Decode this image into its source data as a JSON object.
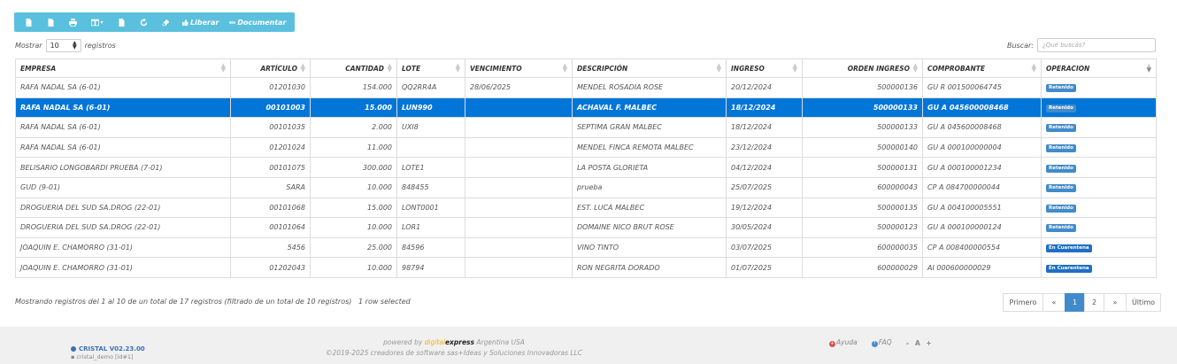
{
  "toolbar": {
    "icons": [
      "file-icon",
      "file-icon",
      "print-icon",
      "columns-icon",
      "file-icon",
      "refresh-icon",
      "eraser-icon"
    ],
    "liberar_label": "Liberar",
    "documentar_label": "Documentar"
  },
  "length": {
    "label_pre": "Mostrar",
    "value": "10",
    "label_post": "registros"
  },
  "search": {
    "label": "Buscar:",
    "placeholder": "¿Qué buscás?"
  },
  "table": {
    "headers": [
      "EMPRESA",
      "ARTÍCULO",
      "CANTIDAD",
      "LOTE",
      "VENCIMIENTO",
      "DESCRIPCIÓN",
      "INGRESO",
      "ORDEN INGRESO",
      "COMPROBANTE",
      "OPERACION"
    ],
    "rows": [
      {
        "empresa": "RAFA NADAL SA (6-01)",
        "articulo": "01201030",
        "cantidad": "154.000",
        "lote": "QQ2RR4A",
        "vencimiento": "28/06/2025",
        "descripcion": "MENDEL ROSADIA ROSE",
        "ingreso": "20/12/2024",
        "orden": "500000136",
        "comprobante": "GU R 001500064745",
        "operacion": "Retenido",
        "selected": false
      },
      {
        "empresa": "RAFA NADAL SA (6-01)",
        "articulo": "00101003",
        "cantidad": "15.000",
        "lote": "LUN990",
        "vencimiento": "",
        "descripcion": "ACHAVAL F. MALBEC",
        "ingreso": "18/12/2024",
        "orden": "500000133",
        "comprobante": "GU A 045600008468",
        "operacion": "Retenido",
        "selected": true
      },
      {
        "empresa": "RAFA NADAL SA (6-01)",
        "articulo": "00101035",
        "cantidad": "2.000",
        "lote": "UXI8",
        "vencimiento": "",
        "descripcion": "SEPTIMA GRAN MALBEC",
        "ingreso": "18/12/2024",
        "orden": "500000133",
        "comprobante": "GU A 045600008468",
        "operacion": "Retenido",
        "selected": false
      },
      {
        "empresa": "RAFA NADAL SA (6-01)",
        "articulo": "01201024",
        "cantidad": "11.000",
        "lote": "",
        "vencimiento": "",
        "descripcion": "MENDEL FINCA REMOTA MALBEC",
        "ingreso": "23/12/2024",
        "orden": "500000140",
        "comprobante": "GU A 000100000004",
        "operacion": "Retenido",
        "selected": false
      },
      {
        "empresa": "BELISARIO LONGOBARDI PRUEBA (7-01)",
        "articulo": "00101075",
        "cantidad": "300.000",
        "lote": "LOTE1",
        "vencimiento": "",
        "descripcion": "LA POSTA GLORIETA",
        "ingreso": "04/12/2024",
        "orden": "500000131",
        "comprobante": "GU A 000100001234",
        "operacion": "Retenido",
        "selected": false
      },
      {
        "empresa": "GUD (9-01)",
        "articulo": "SARA",
        "cantidad": "10.000",
        "lote": "848455",
        "vencimiento": "",
        "descripcion": "prueba",
        "ingreso": "25/07/2025",
        "orden": "600000043",
        "comprobante": "CP A 084700000044",
        "operacion": "Retenido",
        "selected": false
      },
      {
        "empresa": "DROGUERIA DEL SUD SA.DROG (22-01)",
        "articulo": "00101068",
        "cantidad": "15.000",
        "lote": "LONT0001",
        "vencimiento": "",
        "descripcion": "EST. LUCA MALBEC",
        "ingreso": "19/12/2024",
        "orden": "500000135",
        "comprobante": "GU A 004100005551",
        "operacion": "Retenido",
        "selected": false
      },
      {
        "empresa": "DROGUERIA DEL SUD SA.DROG (22-01)",
        "articulo": "00101064",
        "cantidad": "10.000",
        "lote": "LOR1",
        "vencimiento": "",
        "descripcion": "DOMAINE NICO BRUT ROSE",
        "ingreso": "30/05/2024",
        "orden": "500000123",
        "comprobante": "GU A 000100000124",
        "operacion": "Retenido",
        "selected": false
      },
      {
        "empresa": "JOAQUIN E. CHAMORRO (31-01)",
        "articulo": "5456",
        "cantidad": "25.000",
        "lote": "84596",
        "vencimiento": "",
        "descripcion": "VINO TINTO",
        "ingreso": "03/07/2025",
        "orden": "600000035",
        "comprobante": "CP A 008400000554",
        "operacion": "En Cuarentena",
        "selected": false
      },
      {
        "empresa": "JOAQUIN E. CHAMORRO (31-01)",
        "articulo": "01202043",
        "cantidad": "10.000",
        "lote": "98794",
        "vencimiento": "",
        "descripcion": "RON NEGRITA DORADO",
        "ingreso": "01/07/2025",
        "orden": "600000029",
        "comprobante": "AI 000600000029",
        "operacion": "En Cuarentena",
        "selected": false
      }
    ]
  },
  "info": {
    "text": "Mostrando registros del 1 al 10 de un total de 17 registros (filtrado de un total de 10 registros)",
    "selected": "1 row selected"
  },
  "pager": [
    "Primero",
    "«",
    "1",
    "2",
    "»",
    "Último"
  ],
  "footer": {
    "version": "CRISTAL V02.23.00",
    "user": "cristal_demo [id#1]",
    "powered_pre": "powered by ",
    "powered_digital": "digital",
    "powered_express": "express",
    "powered_post": " Argentina USA",
    "copyright": "©2019-2025 creadores de software sas+Ideas y Soluciones Innovadoras LLC",
    "help_label": "Ayuda",
    "faq_label": "FAQ",
    "font_controls": "– A +"
  },
  "colors": {
    "toolbar": "#5bc0de",
    "selected_row": "#0275d8",
    "badge_retenido": "#428bca",
    "badge_cuarentena": "#1f6fc4"
  }
}
